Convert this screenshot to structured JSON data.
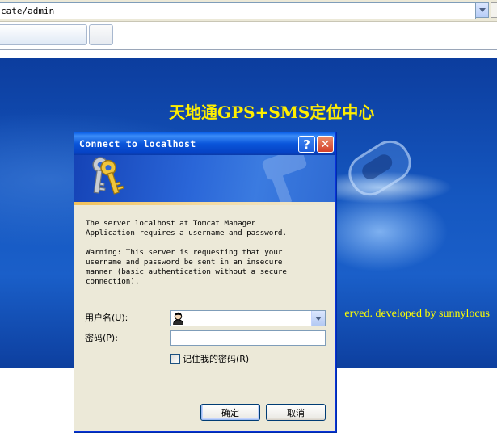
{
  "browser": {
    "address": "cate/admin"
  },
  "page": {
    "title": "天地通GPS+SMS定位中心",
    "footer": "erved. developed by sunnylocus"
  },
  "dialog": {
    "title": "Connect to localhost",
    "help_label": "?",
    "close_label": "✕",
    "message_1": "The server localhost at Tomcat Manager\nApplication requires a username and password.",
    "message_2": "Warning: This server is requesting that your\nusername and password be sent in an insecure\nmanner (basic authentication without a secure\nconnection).",
    "username_label": "用户名(U):",
    "username_value": "",
    "password_label": "密码(P):",
    "password_value": "",
    "remember_label": "记住我的密码(R)",
    "remember_checked": false,
    "ok_label": "确定",
    "cancel_label": "取消"
  },
  "colors": {
    "title_yellow": "#ffee00",
    "xp_blue": "#0a55da",
    "dialog_bg": "#ece9d8"
  },
  "icons": [
    "dropdown-arrow-icon",
    "help-icon",
    "close-icon",
    "keys-icon",
    "user-avatar-icon"
  ]
}
